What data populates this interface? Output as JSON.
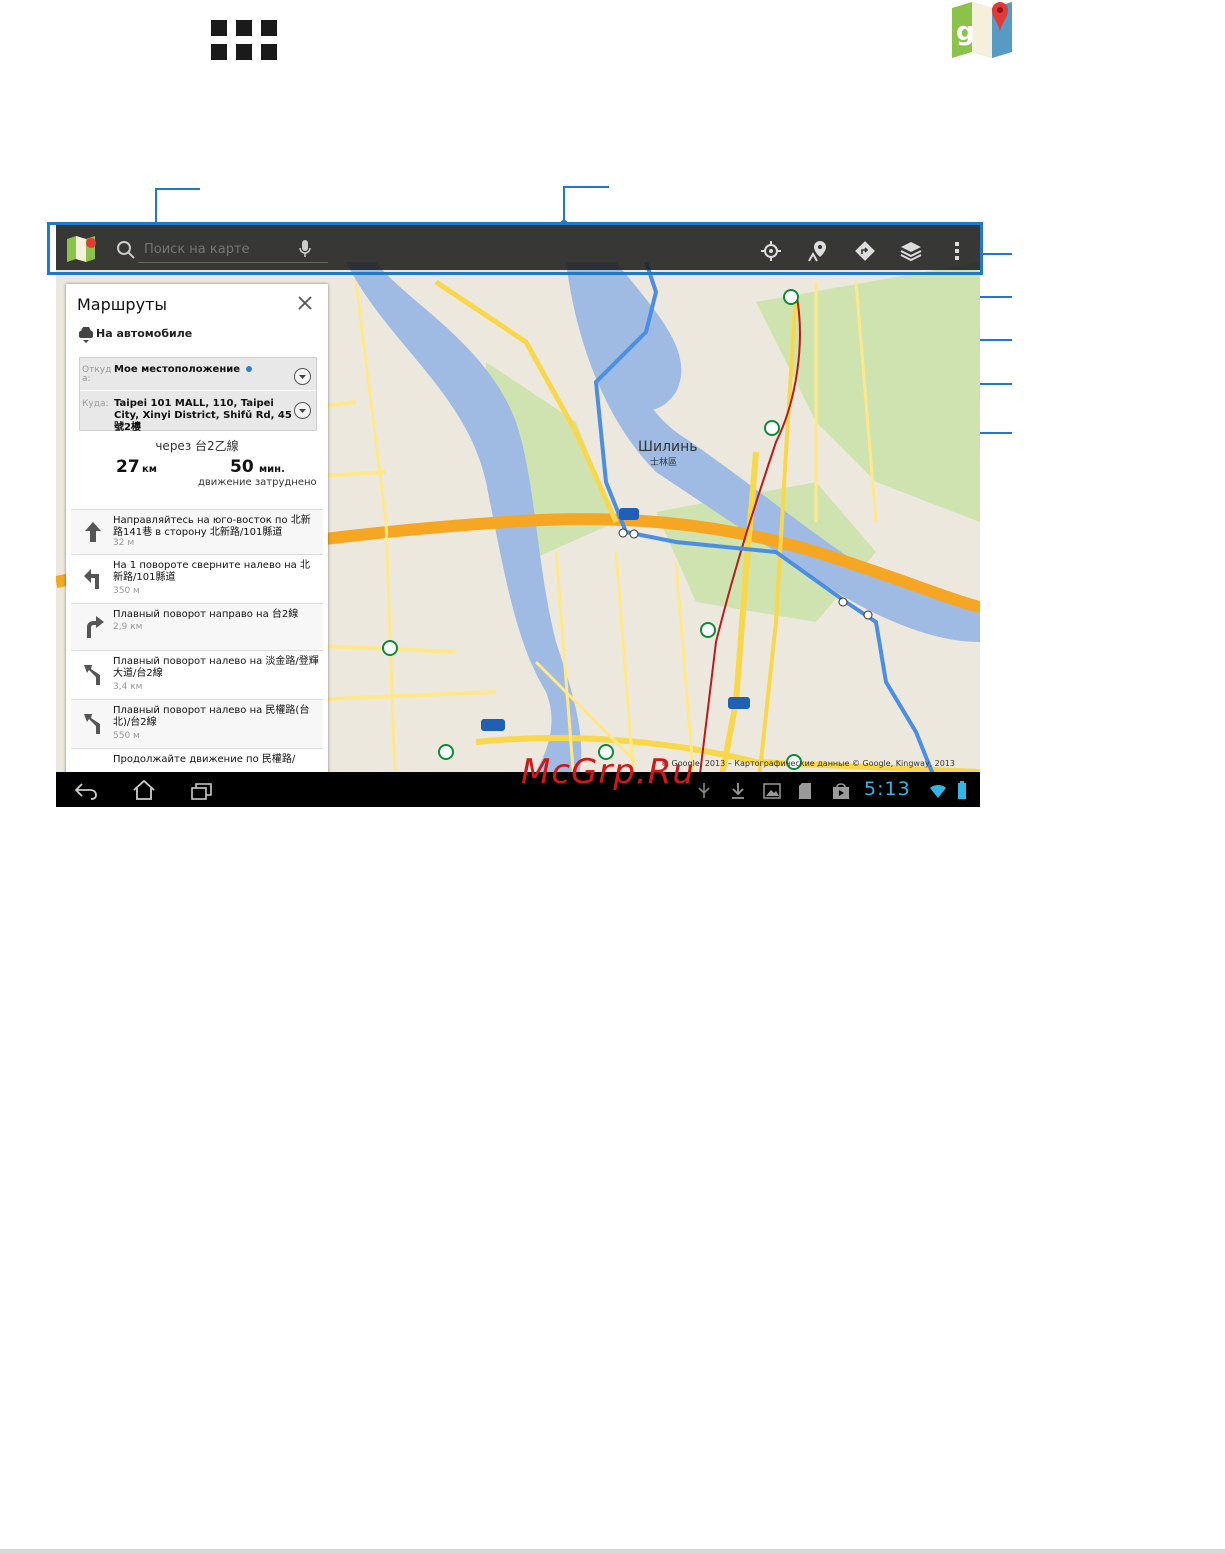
{
  "search": {
    "placeholder": "Поиск на карте"
  },
  "routes": {
    "title": "Маршруты",
    "mode": "На автомобиле",
    "from_caption": "Откуд а:",
    "from_value": "Мое местоположение",
    "to_caption": "Куда:",
    "to_value": "Taipei 101 MALL, 110, Taipei City, Xinyi District, Shifǔ Rd, 45號2樓",
    "via": "через 台2乙線",
    "distance_value": "27",
    "distance_unit": "км",
    "time_value": "50",
    "time_unit": "мин.",
    "traffic": "движение затруднено",
    "steps": [
      {
        "text": "Направляйтесь на юго-восток по 北新路141巷 в сторону 北新路/101縣道",
        "dist": "32 м"
      },
      {
        "text": "На 1 повороте сверните налево на 北新路/101縣道",
        "dist": "350 м"
      },
      {
        "text": "Плавный поворот направо на 台2線",
        "dist": "2,9 км"
      },
      {
        "text": "Плавный поворот налево на 淡金路/登輝大道/台2線",
        "dist": "3,4 км"
      },
      {
        "text": "Плавный поворот налево на 民權路(台北)/台2線",
        "dist": "550 м"
      },
      {
        "text": "Продолжайте движение по 民權路/",
        "dist": ""
      }
    ]
  },
  "map": {
    "district_label": "Шилинь",
    "district_sub": "士林區",
    "copyright": "© Google, 2013 – Картографические данные © Google, Kingway, 2013"
  },
  "status": {
    "clock": "5:13"
  },
  "watermark": "McGrp.Ru",
  "colors": {
    "accent": "#1f79c7",
    "clock": "#33b5e5",
    "route": "#4a8fe2"
  }
}
